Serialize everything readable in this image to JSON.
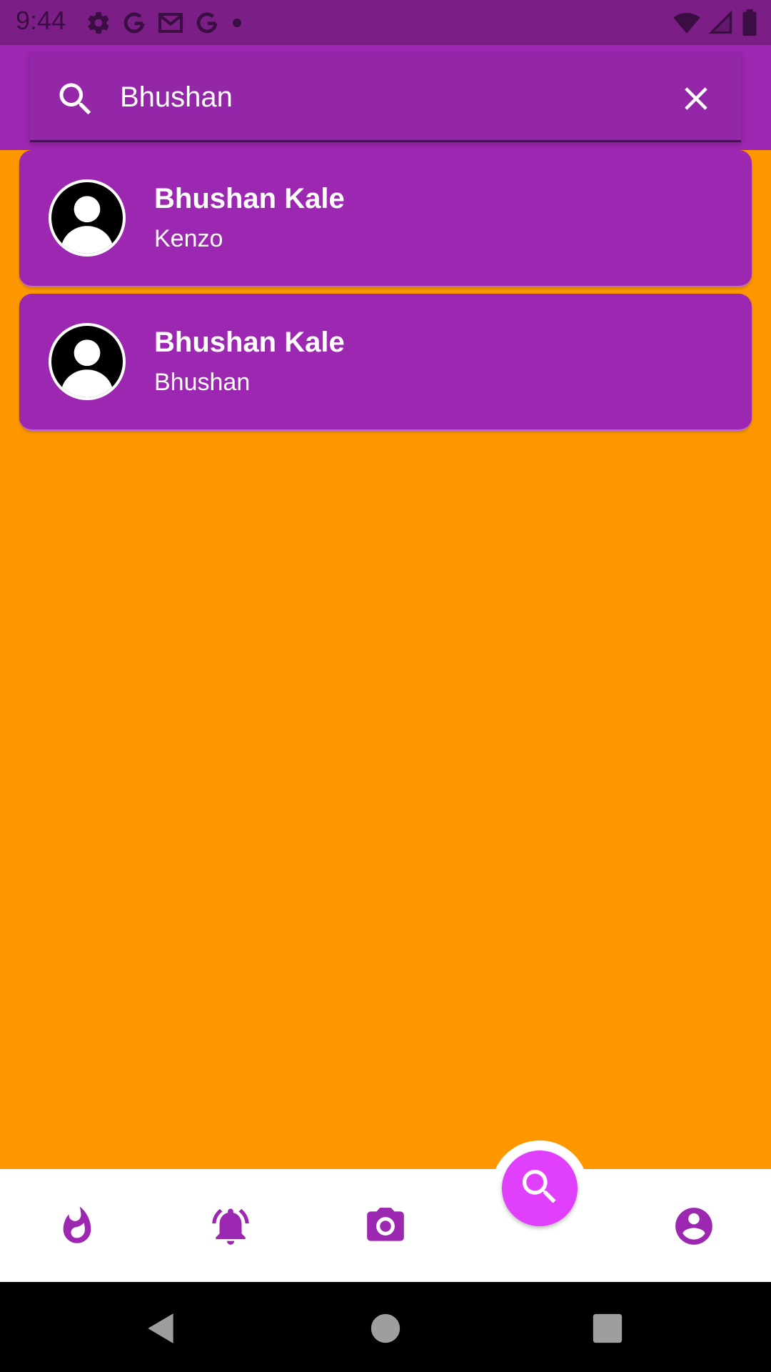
{
  "status_bar": {
    "time": "9:44",
    "left_icons": [
      "gear-icon",
      "google-icon",
      "gmail-icon",
      "google-icon",
      "dot-icon"
    ],
    "right_icons": [
      "wifi-icon",
      "signal-icon",
      "battery-icon"
    ]
  },
  "search": {
    "value": "Bhushan",
    "icon": "search-icon",
    "clear_icon": "close-icon"
  },
  "results": [
    {
      "name": "Bhushan Kale",
      "subtitle": "Kenzo",
      "icon": "avatar-icon"
    },
    {
      "name": "Bhushan Kale",
      "subtitle": "Bhushan",
      "icon": "avatar-icon"
    }
  ],
  "bottom_nav": {
    "items": [
      "flame-icon",
      "bell-icon",
      "camera-icon",
      "search-icon",
      "account-icon"
    ],
    "active": "search-icon"
  },
  "system_nav": [
    "back-icon",
    "home-icon",
    "recents-icon"
  ],
  "colors": {
    "status_bar": "#7b1f87",
    "app_bar": "#9c27b0",
    "background": "#ff9800",
    "card": "#9c27b0",
    "fab": "#e040fb",
    "nav_icon": "#9c27b0"
  }
}
